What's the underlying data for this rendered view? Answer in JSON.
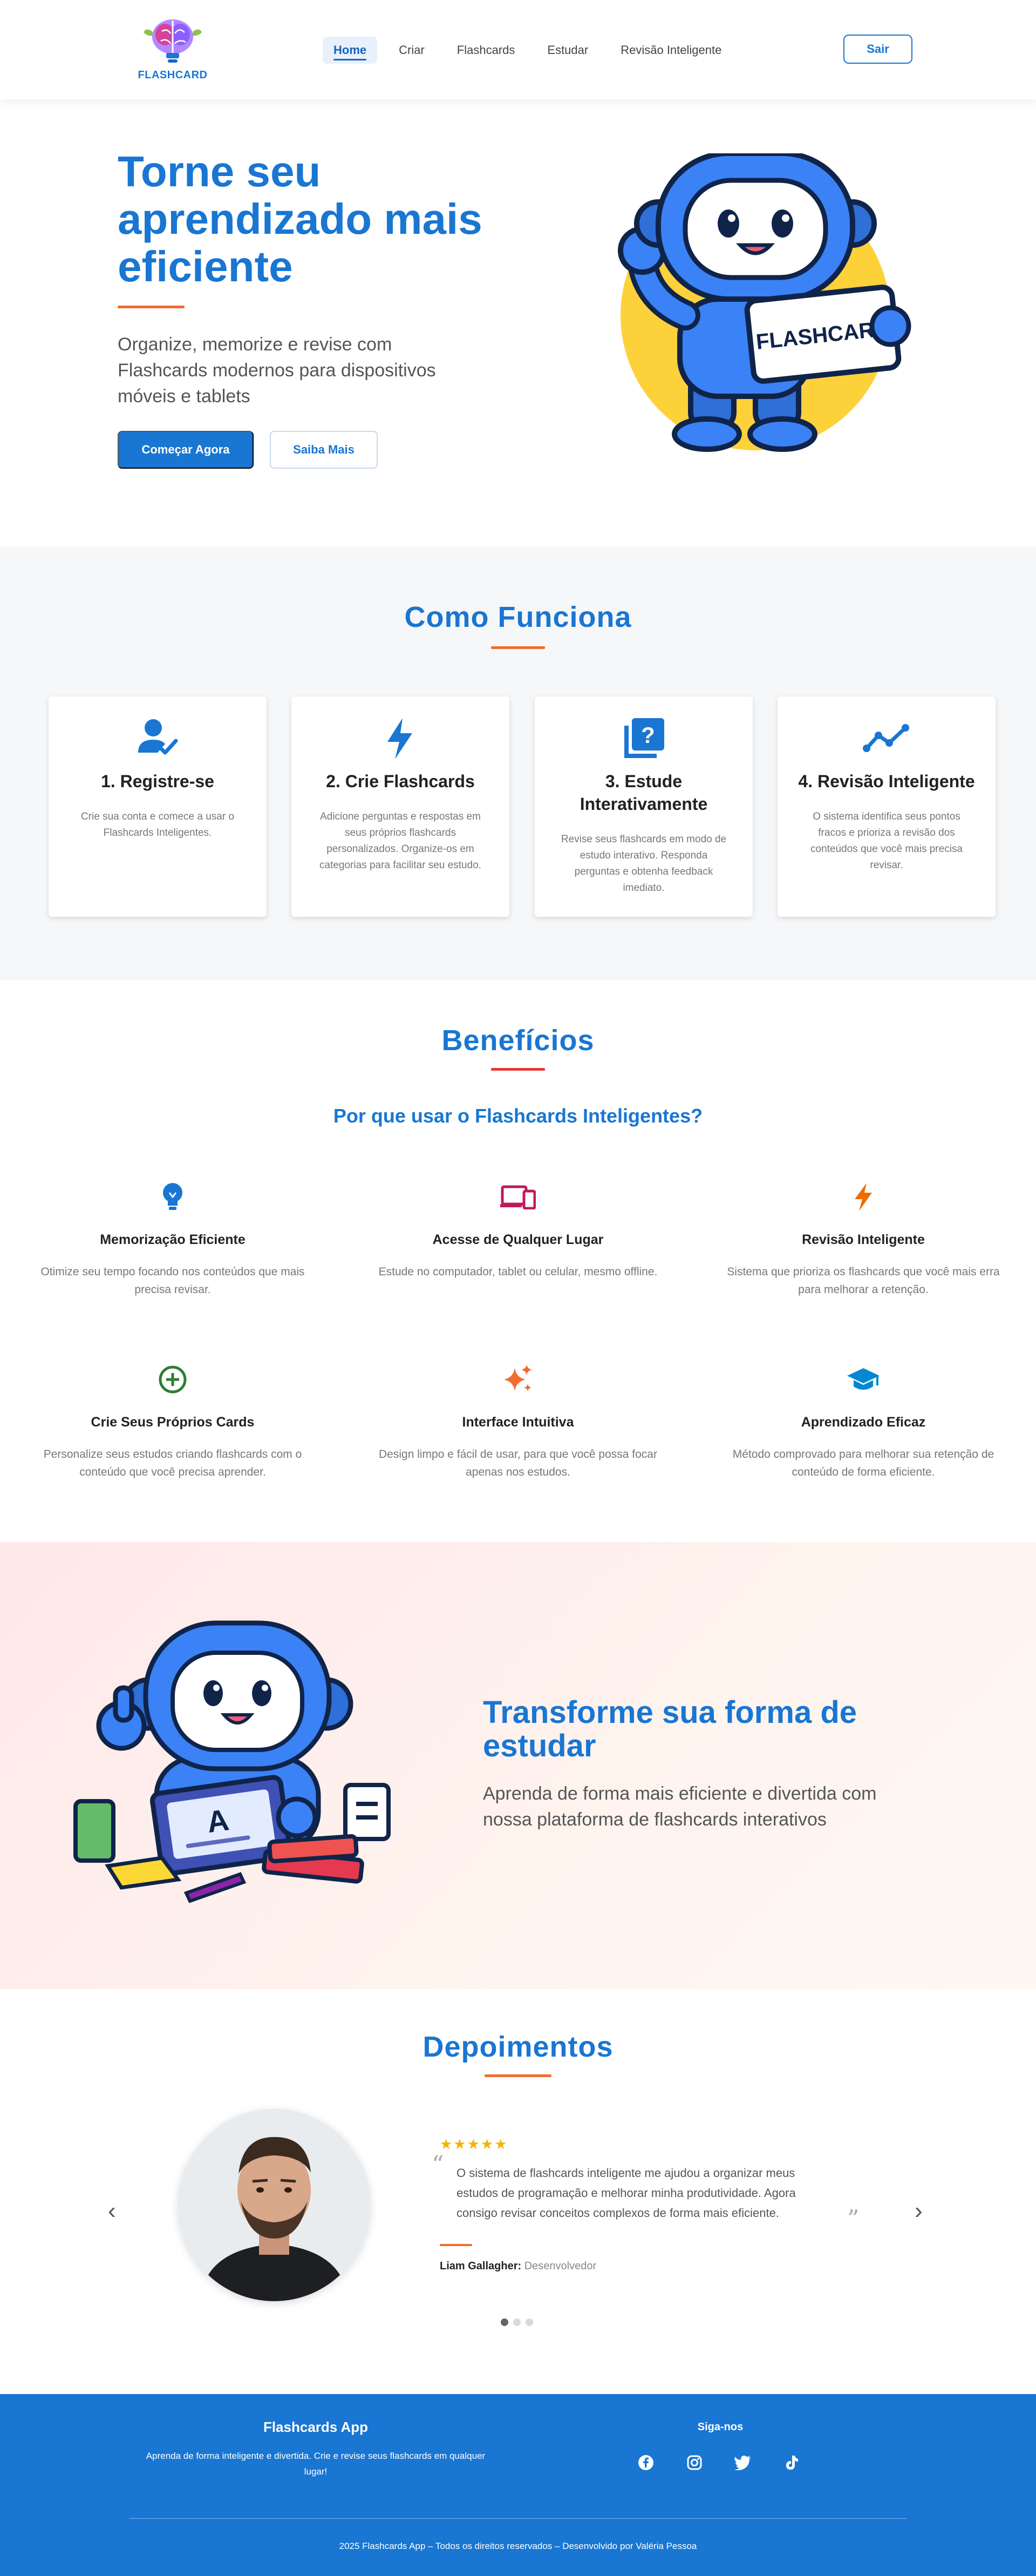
{
  "navbar": {
    "logo_text": "FLASHCARD",
    "links": [
      {
        "label": "Home",
        "active": true
      },
      {
        "label": "Criar",
        "active": false
      },
      {
        "label": "Flashcards",
        "active": false
      },
      {
        "label": "Estudar",
        "active": false
      },
      {
        "label": "Revisão Inteligente",
        "active": false
      }
    ],
    "logout_label": "Sair"
  },
  "hero": {
    "title": "Torne seu aprendizado mais eficiente",
    "subtitle": "Organize, memorize e revise com Flashcards modernos para dispositivos móveis e tablets",
    "primary_button": "Começar Agora",
    "secondary_button": "Saiba Mais",
    "mascot_card_text": "FLASHCARD"
  },
  "how_it_works": {
    "title": "Como Funciona",
    "steps": [
      {
        "title": "1. Registre-se",
        "text": "Crie sua conta e comece a usar o Flashcards Inteligentes.",
        "icon": "user-check-icon"
      },
      {
        "title": "2. Crie Flashcards",
        "text": "Adicione perguntas e respostas em seus próprios flashcards personalizados. Organize-os em categorias para facilitar seu estudo.",
        "icon": "lightning-icon"
      },
      {
        "title": "3. Estude Interativamente",
        "text": "Revise seus flashcards em modo de estudo interativo. Responda perguntas e obtenha feedback imediato.",
        "icon": "quiz-icon"
      },
      {
        "title": "4. Revisão Inteligente",
        "text": "O sistema identifica seus pontos fracos e prioriza a revisão dos conteúdos que você mais precisa revisar.",
        "icon": "trend-icon"
      }
    ]
  },
  "benefits": {
    "title": "Benefícios",
    "subtitle": "Por que usar o Flashcards Inteligentes?",
    "items": [
      {
        "title": "Memorização Eficiente",
        "text": "Otimize seu tempo focando nos conteúdos que mais precisa revisar.",
        "icon": "lightbulb-icon",
        "color": "#1976d2"
      },
      {
        "title": "Acesse de Qualquer Lugar",
        "text": "Estude no computador, tablet ou celular, mesmo offline.",
        "icon": "devices-icon",
        "color": "#c2185b"
      },
      {
        "title": "Revisão Inteligente",
        "text": "Sistema que prioriza os flashcards que você mais erra para melhorar a retenção.",
        "icon": "bolt-icon",
        "color": "#ef6c00"
      },
      {
        "title": "Crie Seus Próprios Cards",
        "text": "Personalize seus estudos criando flashcards com o conteúdo que você precisa aprender.",
        "icon": "add-circle-icon",
        "color": "#2e7d32"
      },
      {
        "title": "Interface Intuitiva",
        "text": "Design limpo e fácil de usar, para que você possa focar apenas nos estudos.",
        "icon": "sparkle-icon",
        "color": "#f26b2f"
      },
      {
        "title": "Aprendizado Eficaz",
        "text": "Método comprovado para melhorar sua retenção de conteúdo de forma eficiente.",
        "icon": "graduation-cap-icon",
        "color": "#0288d1"
      }
    ]
  },
  "transform": {
    "title": "Transforme sua forma de estudar",
    "subtitle": "Aprenda de forma mais eficiente e divertida com nossa plataforma de flashcards interativos",
    "laptop_letter": "A"
  },
  "testimonials": {
    "title": "Depoimentos",
    "stars": "★★★★★",
    "rating": 5,
    "open_quote": "“",
    "close_quote": "”",
    "quote": "O sistema de flashcards inteligente me ajudou a organizar meus estudos de programação e melhorar minha produtividade. Agora consigo revisar conceitos complexos de forma mais eficiente.",
    "author_name": "Liam Gallagher:",
    "author_role": "Desenvolvedor",
    "prev_arrow": "‹",
    "next_arrow": "›",
    "active_slide": 1,
    "total_slides": 3
  },
  "footer": {
    "title": "Flashcards App",
    "description": "Aprenda de forma inteligente e divertida. Crie e revise seus flashcards em qualquer lugar!",
    "follow_title": "Siga-nos",
    "socials": [
      "facebook-icon",
      "instagram-icon",
      "twitter-icon",
      "tiktok-icon"
    ],
    "copyright": "2025 Flashcards App – Todos os direitos reservados – Desenvolvido por Valéria Pessoa"
  },
  "colors": {
    "primary": "#1976d2",
    "accent": "#f26b2f",
    "star": "#f5b301"
  }
}
